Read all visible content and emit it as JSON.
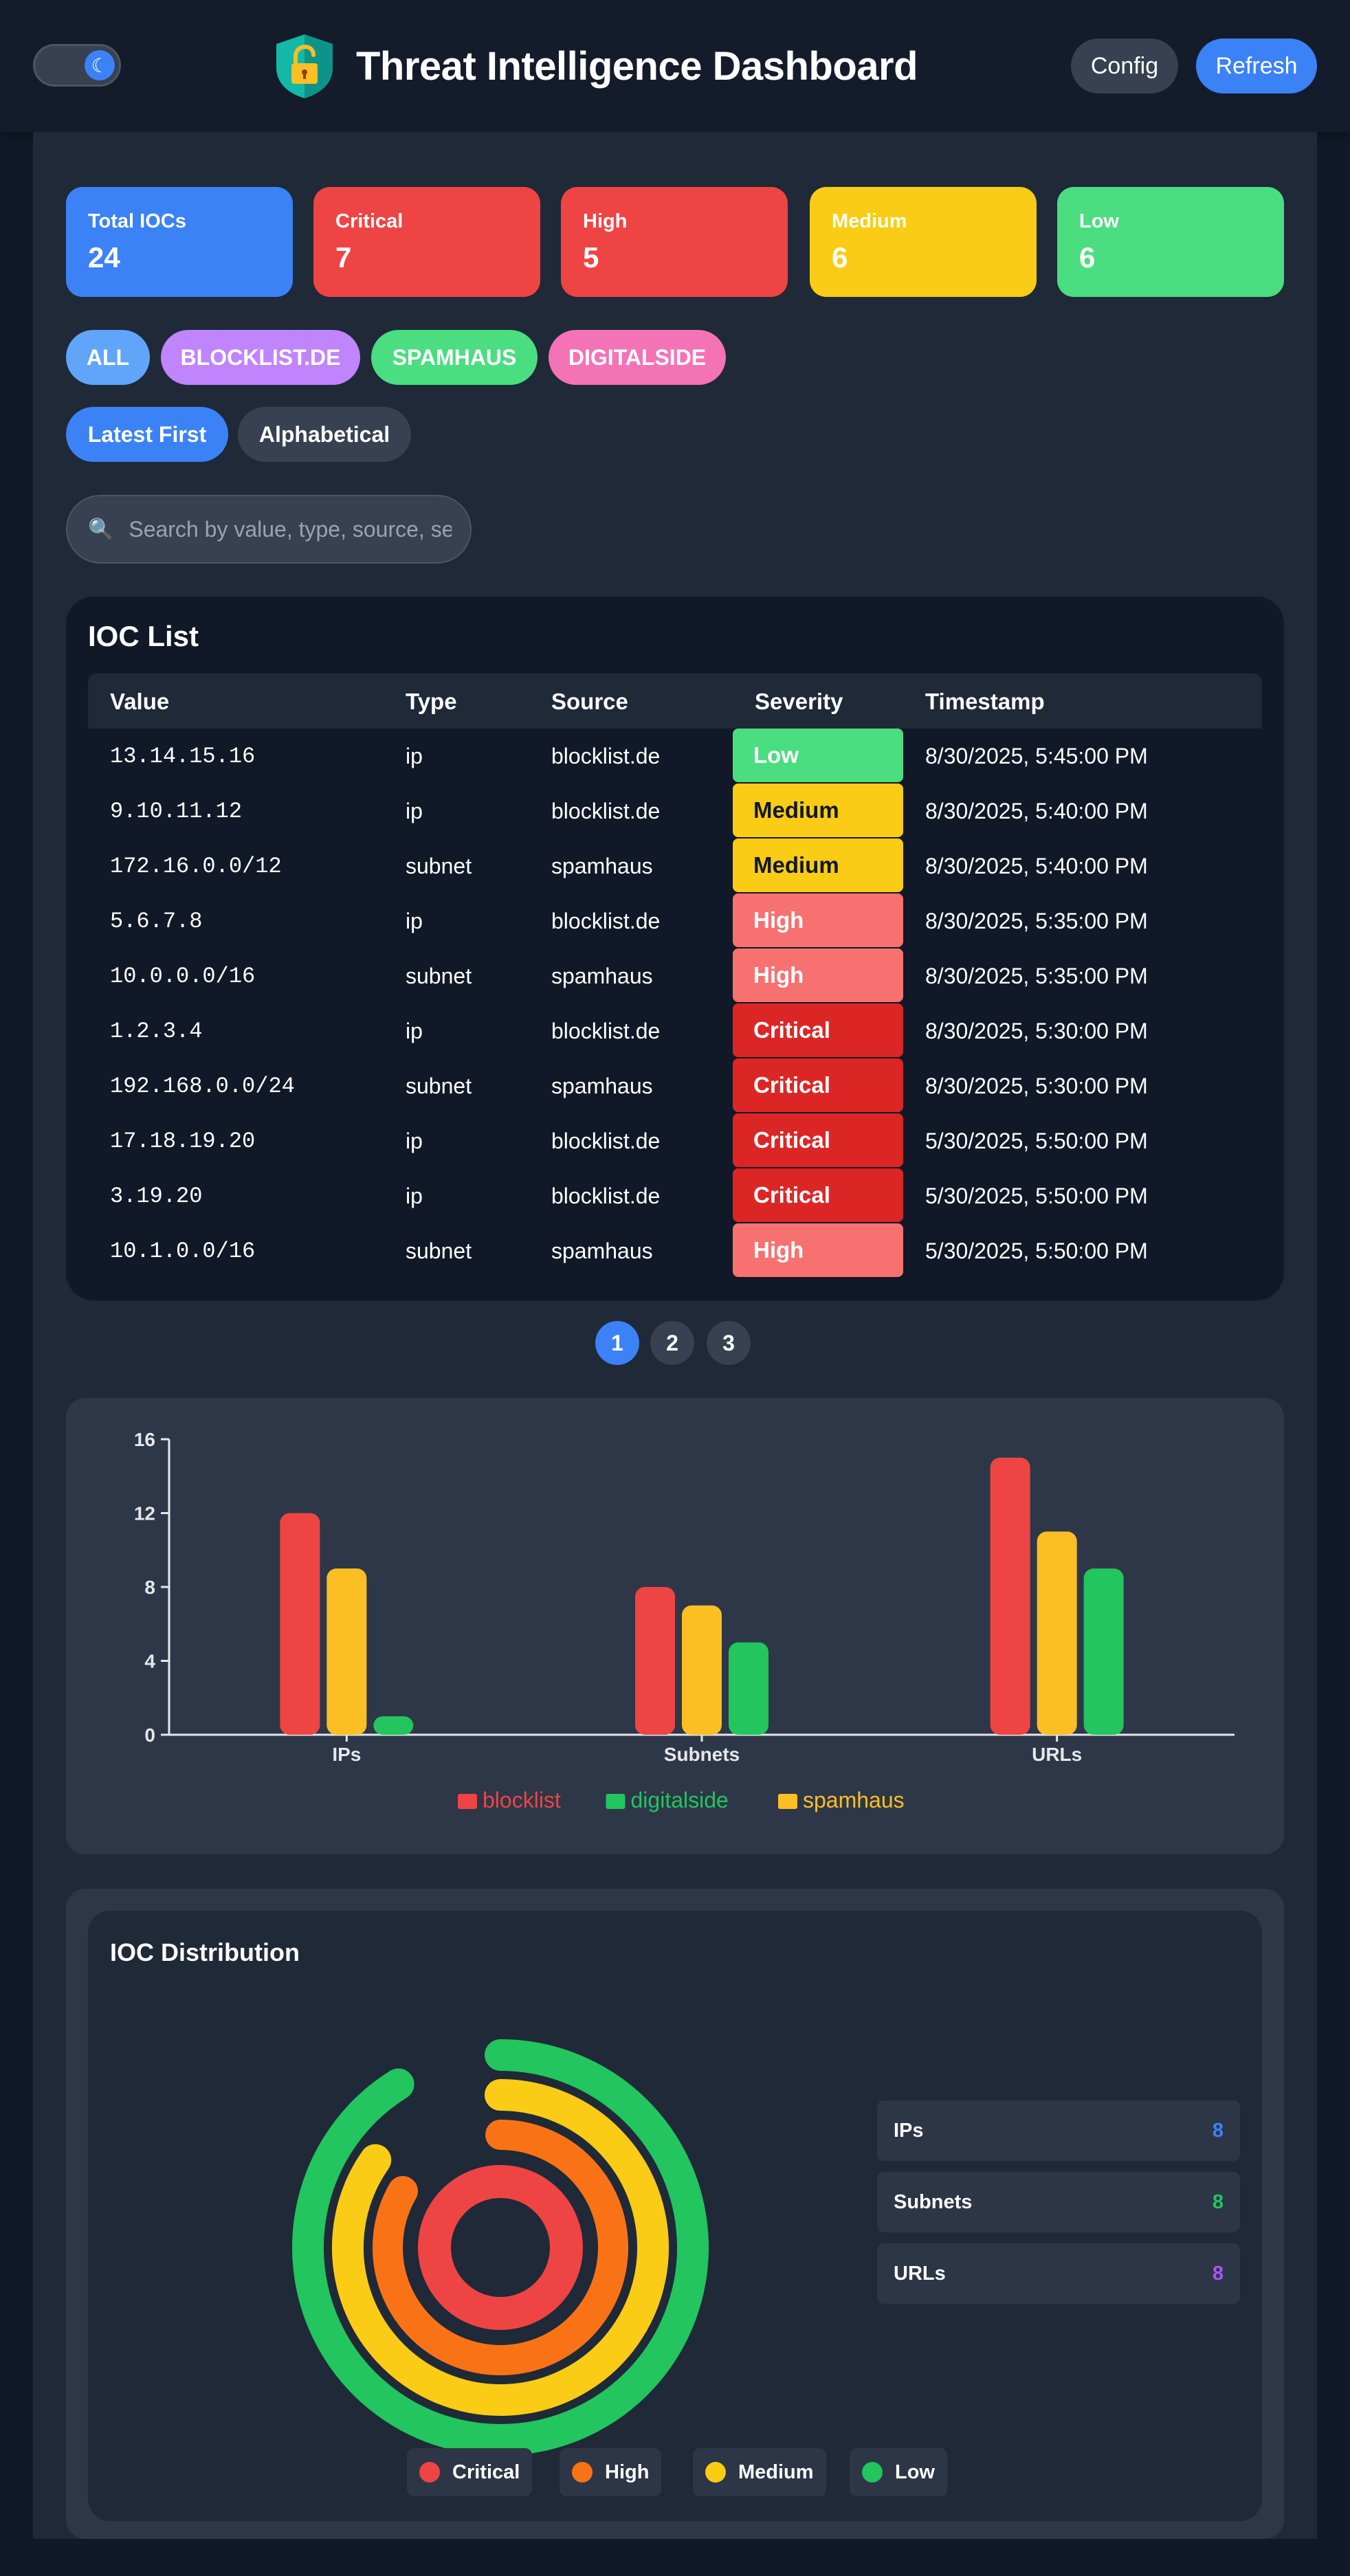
{
  "header": {
    "theme_icon": "moon-icon",
    "title": "Threat Intelligence Dashboard",
    "config_label": "Config",
    "refresh_label": "Refresh"
  },
  "stats": [
    {
      "label": "Total IOCs",
      "value": "24",
      "color": "#3b82f6"
    },
    {
      "label": "Critical",
      "value": "7",
      "color": "#ef4444"
    },
    {
      "label": "High",
      "value": "5",
      "color": "#ef4444"
    },
    {
      "label": "Medium",
      "value": "6",
      "color": "#facc15"
    },
    {
      "label": "Low",
      "value": "6",
      "color": "#4ade80"
    }
  ],
  "filters": [
    {
      "label": "ALL",
      "color": "#60a5fa"
    },
    {
      "label": "BLOCKLIST.DE",
      "color": "#c084fc"
    },
    {
      "label": "SPAMHAUS",
      "color": "#4ade80"
    },
    {
      "label": "DIGITALSIDE",
      "color": "#f472b6"
    }
  ],
  "sort": {
    "latest": "Latest First",
    "alpha": "Alphabetical"
  },
  "search": {
    "placeholder": "Search by value, type, source, se"
  },
  "ioc_list": {
    "title": "IOC List",
    "columns": [
      "Value",
      "Type",
      "Source",
      "Severity",
      "Timestamp"
    ],
    "rows": [
      {
        "value": "13.14.15.16",
        "type": "ip",
        "source": "blocklist.de",
        "severity": "Low",
        "timestamp": "8/30/2025, 5:45:00 PM"
      },
      {
        "value": "9.10.11.12",
        "type": "ip",
        "source": "blocklist.de",
        "severity": "Medium",
        "timestamp": "8/30/2025, 5:40:00 PM"
      },
      {
        "value": "172.16.0.0/12",
        "type": "subnet",
        "source": "spamhaus",
        "severity": "Medium",
        "timestamp": "8/30/2025, 5:40:00 PM"
      },
      {
        "value": "5.6.7.8",
        "type": "ip",
        "source": "blocklist.de",
        "severity": "High",
        "timestamp": "8/30/2025, 5:35:00 PM"
      },
      {
        "value": "10.0.0.0/16",
        "type": "subnet",
        "source": "spamhaus",
        "severity": "High",
        "timestamp": "8/30/2025, 5:35:00 PM"
      },
      {
        "value": "1.2.3.4",
        "type": "ip",
        "source": "blocklist.de",
        "severity": "Critical",
        "timestamp": "8/30/2025, 5:30:00 PM"
      },
      {
        "value": "192.168.0.0/24",
        "type": "subnet",
        "source": "spamhaus",
        "severity": "Critical",
        "timestamp": "8/30/2025, 5:30:00 PM"
      },
      {
        "value": "17.18.19.20",
        "type": "ip",
        "source": "blocklist.de",
        "severity": "Critical",
        "timestamp": "5/30/2025, 5:50:00 PM"
      },
      {
        "value": "3.19.20",
        "type": "ip",
        "source": "blocklist.de",
        "severity": "Critical",
        "timestamp": "5/30/2025, 5:50:00 PM"
      },
      {
        "value": "10.1.0.0/16",
        "type": "subnet",
        "source": "spamhaus",
        "severity": "High",
        "timestamp": "5/30/2025, 5:50:00 PM"
      }
    ]
  },
  "severity_colors": {
    "Low": {
      "bg": "#4ade80",
      "fg": "#ffffff"
    },
    "Medium": {
      "bg": "#facc15",
      "fg": "#111827"
    },
    "High": {
      "bg": "#f87171",
      "fg": "#ffffff"
    },
    "Critical": {
      "bg": "#dc2626",
      "fg": "#ffffff"
    }
  },
  "pagination": [
    "1",
    "2",
    "3"
  ],
  "chart_data": {
    "type": "bar",
    "categories": [
      "IPs",
      "Subnets",
      "URLs"
    ],
    "series": [
      {
        "name": "blocklist",
        "color": "#ef4444",
        "values": [
          12,
          8,
          15
        ]
      },
      {
        "name": "spamhaus",
        "color": "#fbbf24",
        "values": [
          9,
          7,
          11
        ]
      },
      {
        "name": "digitalside",
        "color": "#22c55e",
        "values": [
          1,
          5,
          9
        ]
      }
    ],
    "legend_order": [
      "blocklist",
      "digitalside",
      "spamhaus"
    ],
    "ylim": [
      0,
      16
    ],
    "yticks": [
      "0",
      "4",
      "8",
      "12",
      "16"
    ],
    "legend": "bottom"
  },
  "distribution": {
    "title": "IOC Distribution",
    "rings": [
      {
        "name": "Critical",
        "color": "#ef4444"
      },
      {
        "name": "High",
        "color": "#f97316"
      },
      {
        "name": "Medium",
        "color": "#facc15"
      },
      {
        "name": "Low",
        "color": "#22c55e"
      }
    ],
    "stats": [
      {
        "label": "IPs",
        "value": "8",
        "color": "#3b82f6"
      },
      {
        "label": "Subnets",
        "value": "8",
        "color": "#22c55e"
      },
      {
        "label": "URLs",
        "value": "8",
        "color": "#a855f7"
      }
    ]
  }
}
